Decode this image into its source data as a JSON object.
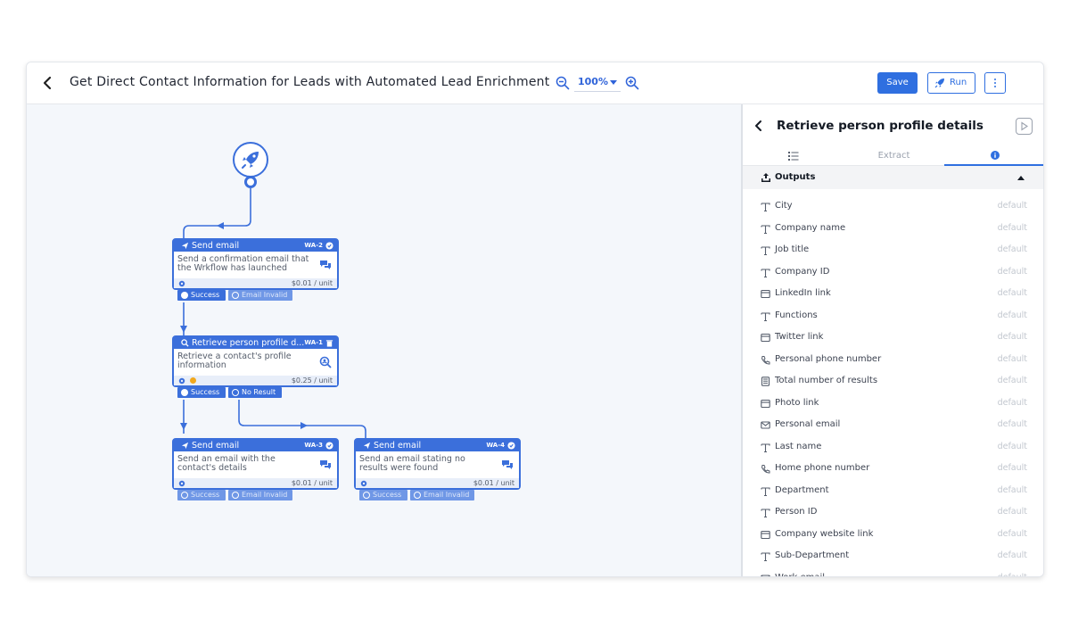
{
  "header": {
    "title": "Get Direct Contact Information for Leads with Automated Lead Enrichment",
    "zoom": "100%",
    "save_label": "Save",
    "run_label": "Run"
  },
  "colors": {
    "accent": "#2f6fe0",
    "node": "#3b6fdb",
    "canvas": "#f4f7fb",
    "chat": "#e8484a"
  },
  "workflow": {
    "nodes": [
      {
        "id": "wa2",
        "title": "Send email",
        "code": "WA-2",
        "description": "Send a confirmation email that the Wrkflow has launched",
        "price": "$0.01 / unit",
        "outputs": [
          "Success",
          "Email Invalid"
        ]
      },
      {
        "id": "wa1",
        "title": "Retrieve person profile d...",
        "code": "WA-1",
        "description": "Retrieve a contact's profile information",
        "price": "$0.25 / unit",
        "outputs": [
          "Success",
          "No Result"
        ]
      },
      {
        "id": "wa3",
        "title": "Send email",
        "code": "WA-3",
        "description": "Send an email with the contact's details",
        "price": "$0.01 / unit",
        "outputs": [
          "Success",
          "Email Invalid"
        ]
      },
      {
        "id": "wa4",
        "title": "Send email",
        "code": "WA-4",
        "description": "Send an email stating no results were found",
        "price": "$0.01 / unit",
        "outputs": [
          "Success",
          "Email Invalid"
        ]
      }
    ]
  },
  "panel": {
    "title": "Retrieve person profile details",
    "tabs": [
      {
        "label": "",
        "icon": "list-icon"
      },
      {
        "label": "Extract",
        "icon": ""
      },
      {
        "label": "",
        "icon": "info-icon"
      }
    ],
    "outputs_label": "Outputs",
    "fields": [
      {
        "label": "City",
        "icon": "text-icon",
        "default": "default"
      },
      {
        "label": "Company name",
        "icon": "text-icon",
        "default": "default"
      },
      {
        "label": "Job title",
        "icon": "text-icon",
        "default": "default"
      },
      {
        "label": "Company ID",
        "icon": "text-icon",
        "default": "default"
      },
      {
        "label": "LinkedIn link",
        "icon": "link-icon",
        "default": "default"
      },
      {
        "label": "Functions",
        "icon": "text-icon",
        "default": "default"
      },
      {
        "label": "Twitter link",
        "icon": "link-icon",
        "default": "default"
      },
      {
        "label": "Personal phone number",
        "icon": "phone-icon",
        "default": "default"
      },
      {
        "label": "Total number of results",
        "icon": "number-icon",
        "default": "default"
      },
      {
        "label": "Photo link",
        "icon": "link-icon",
        "default": "default"
      },
      {
        "label": "Personal email",
        "icon": "email-icon",
        "default": "default"
      },
      {
        "label": "Last name",
        "icon": "text-icon",
        "default": "default"
      },
      {
        "label": "Home phone number",
        "icon": "phone-icon",
        "default": "default"
      },
      {
        "label": "Department",
        "icon": "text-icon",
        "default": "default"
      },
      {
        "label": "Person ID",
        "icon": "text-icon",
        "default": "default"
      },
      {
        "label": "Company website link",
        "icon": "link-icon",
        "default": "default"
      },
      {
        "label": "Sub-Department",
        "icon": "text-icon",
        "default": "default"
      },
      {
        "label": "Work email",
        "icon": "email-icon",
        "default": "default"
      }
    ]
  }
}
